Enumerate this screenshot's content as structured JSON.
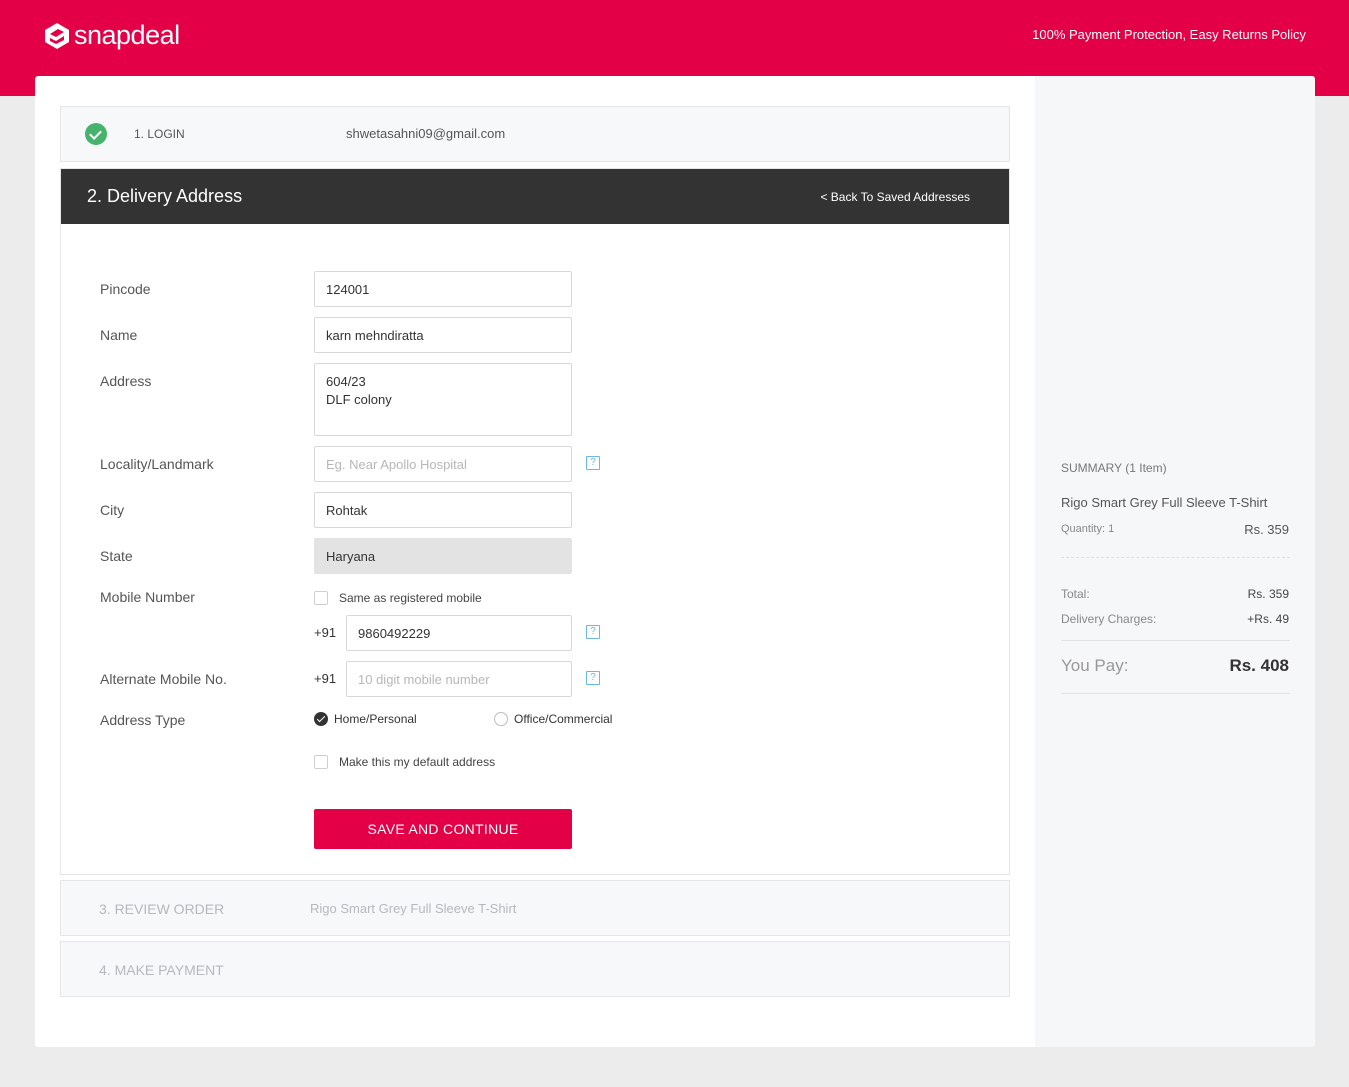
{
  "header": {
    "brand": "snapdeal",
    "tagline": "100% Payment Protection, Easy Returns Policy"
  },
  "steps": {
    "login": {
      "title": "1. LOGIN",
      "email": "shwetasahni09@gmail.com"
    },
    "address": {
      "title": "2. Delivery Address",
      "back_link": "< Back To Saved Addresses"
    },
    "review": {
      "title": "3. REVIEW ORDER",
      "info": "Rigo Smart Grey Full Sleeve T-Shirt"
    },
    "payment": {
      "title": "4. MAKE PAYMENT"
    }
  },
  "form": {
    "pincode": {
      "label": "Pincode",
      "value": "124001"
    },
    "name": {
      "label": "Name",
      "value": "karn mehndiratta"
    },
    "address": {
      "label": "Address",
      "line1": "604/23",
      "line2": "DLF colony"
    },
    "locality": {
      "label": "Locality/Landmark",
      "placeholder": "Eg. Near Apollo Hospital"
    },
    "city": {
      "label": "City",
      "value": "Rohtak"
    },
    "state": {
      "label": "State",
      "value": "Haryana"
    },
    "mobile": {
      "label": "Mobile Number",
      "same_as_label": "Same as registered mobile",
      "prefix": "+91",
      "value": "9860492229"
    },
    "alt_mobile": {
      "label": "Alternate Mobile No.",
      "prefix": "+91",
      "placeholder": "10 digit mobile number"
    },
    "address_type": {
      "label": "Address Type",
      "options": [
        "Home/Personal",
        "Office/Commercial"
      ],
      "selected": "Home/Personal"
    },
    "default_label": "Make this my default address",
    "help_glyph": "?",
    "submit_label": "SAVE AND CONTINUE"
  },
  "summary": {
    "title": "SUMMARY (1 Item)",
    "item_name": "Rigo Smart Grey Full Sleeve T-Shirt",
    "quantity": "Quantity: 1",
    "item_price": "Rs. 359",
    "total_label": "Total:",
    "total_value": "Rs. 359",
    "delivery_label": "Delivery Charges:",
    "delivery_value": "+Rs. 49",
    "pay_label": "You Pay:",
    "pay_value": "Rs. 408"
  },
  "colors": {
    "brand": "#e40046",
    "header_dark": "#333333",
    "success": "#46b36c",
    "help": "#6db7e6"
  }
}
